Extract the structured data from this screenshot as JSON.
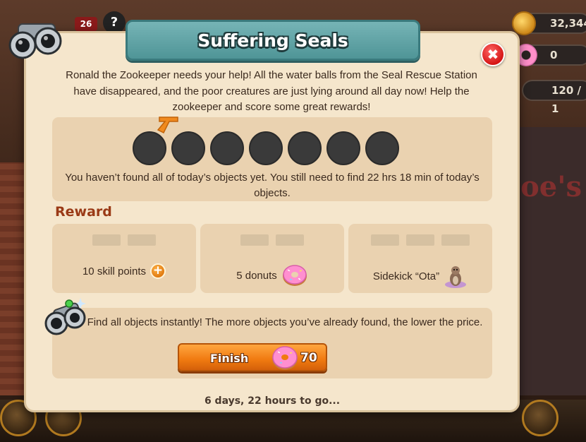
{
  "hud": {
    "coins": "32,344",
    "donuts": "0",
    "energy": "120 / 1",
    "notification_count": "26",
    "help_symbol": "?"
  },
  "dialog": {
    "title": "Suffering Seals",
    "intro": "Ronald the Zookeeper needs your help! All the water balls from the Seal Rescue Station have disappeared, and the poor creatures are just lying around all day now! Help the zookeeper and score some great rewards!",
    "progress": {
      "slots_total": 7,
      "slots_found": 0,
      "message": "You haven’t found all of today’s objects yet. You still need to find 22 hrs 18 min of today’s objects."
    },
    "reward_heading": "Reward",
    "rewards": [
      {
        "label": "10 skill points",
        "icon": "plus-icon"
      },
      {
        "label": "5 donuts",
        "icon": "donut-icon"
      },
      {
        "label": "Sidekick “Ota”",
        "icon": "otter-icon"
      }
    ],
    "finish": {
      "text": "Find all objects instantly! The more objects you’ve already found, the lower the price.",
      "button_label": "Finish",
      "price": "70"
    },
    "timer": "6 days, 22 hours to go..."
  },
  "colors": {
    "banner": "#5fa3a5",
    "dialog_bg": "#f5e6cc",
    "panel_bg": "#ead2b0",
    "reward_heading": "#9a3a16",
    "finish_button": "#f07a10",
    "close_button": "#d51515"
  }
}
